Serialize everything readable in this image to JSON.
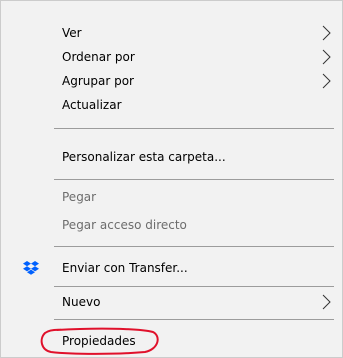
{
  "menu": {
    "items": [
      {
        "label": "Ver",
        "submenu": true,
        "disabled": false
      },
      {
        "label": "Ordenar por",
        "submenu": true,
        "disabled": false
      },
      {
        "label": "Agrupar por",
        "submenu": true,
        "disabled": false
      },
      {
        "label": "Actualizar",
        "submenu": false,
        "disabled": false
      },
      {
        "label": "Personalizar esta carpeta...",
        "submenu": false,
        "disabled": false
      },
      {
        "label": "Pegar",
        "submenu": false,
        "disabled": true
      },
      {
        "label": "Pegar acceso directo",
        "submenu": false,
        "disabled": true
      },
      {
        "label": "Enviar con Transfer...",
        "submenu": false,
        "disabled": false,
        "icon": "dropbox-icon"
      },
      {
        "label": "Nuevo",
        "submenu": true,
        "disabled": false
      },
      {
        "label": "Propiedades",
        "submenu": false,
        "disabled": false
      }
    ]
  },
  "colors": {
    "menu_background": "#f2f2f2",
    "disabled_text": "#6d6d6d",
    "separator": "#9c9c9c",
    "dropbox_blue": "#0061fe",
    "annotation_red": "#e0112b"
  }
}
